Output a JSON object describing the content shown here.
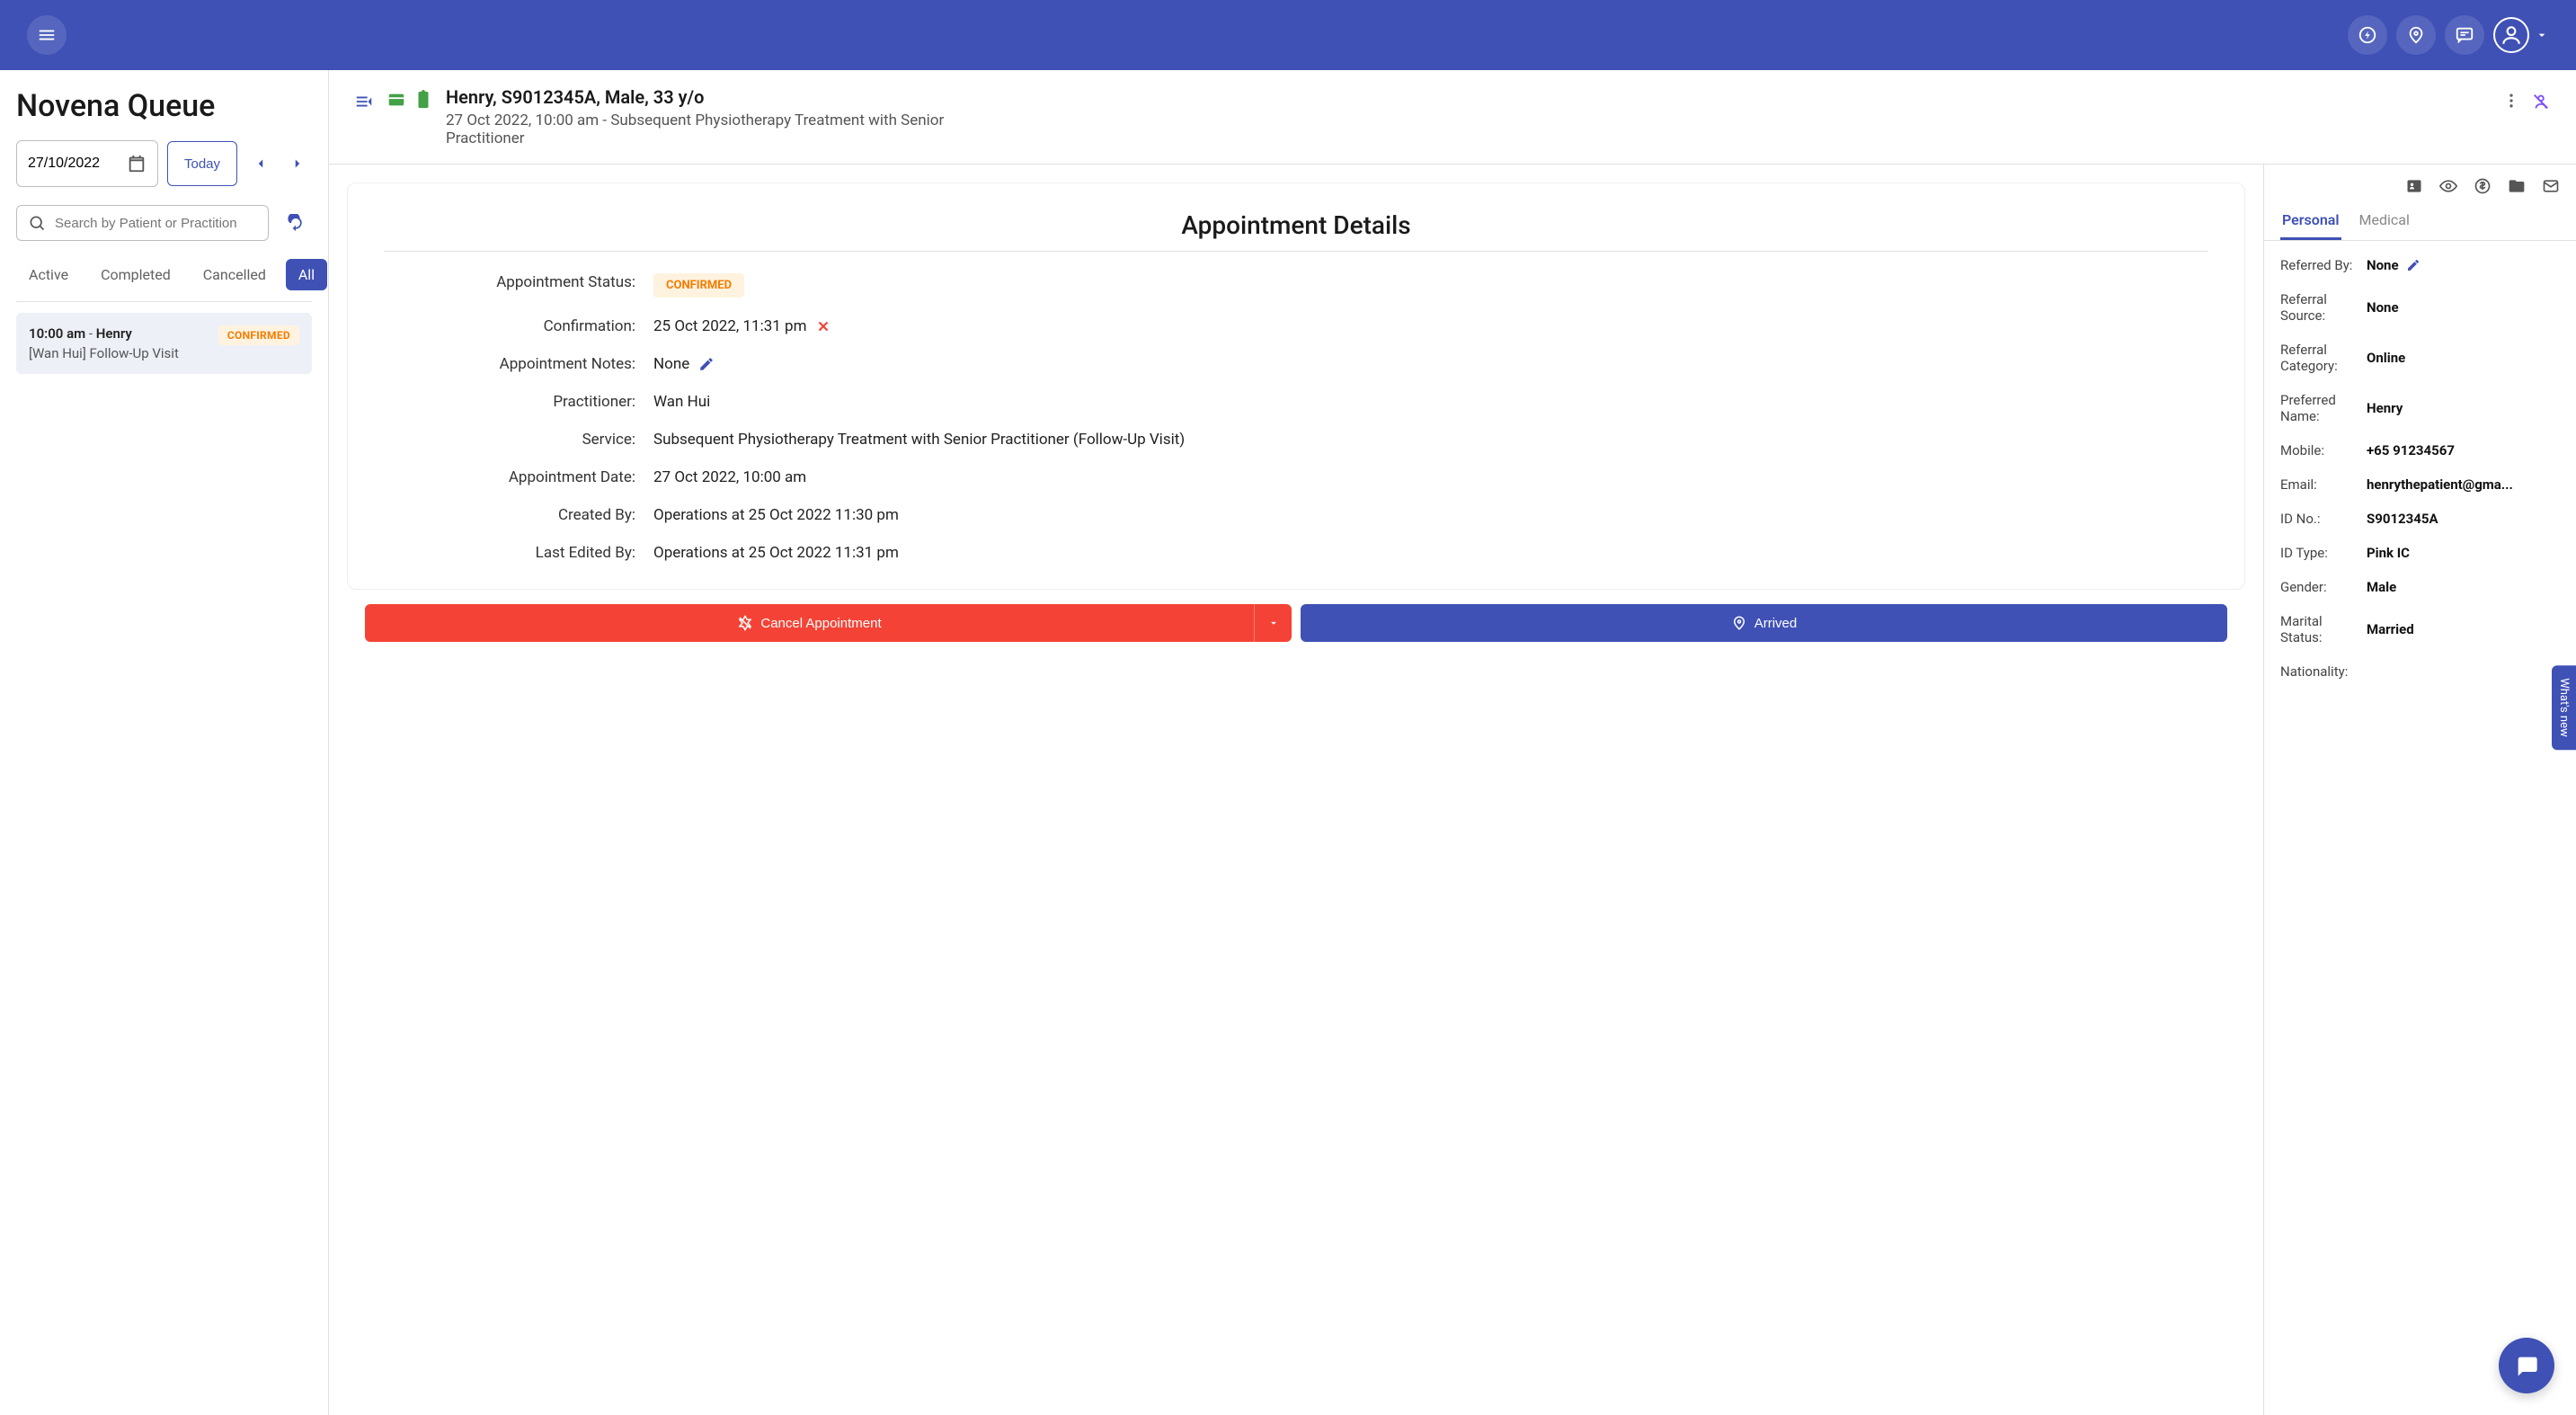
{
  "sidebar": {
    "title": "Novena Queue",
    "date": "27/10/2022",
    "today_label": "Today",
    "search_placeholder": "Search by Patient or Practition",
    "tabs": [
      "Active",
      "Completed",
      "Cancelled",
      "All"
    ],
    "active_tab": 3,
    "queue": [
      {
        "time": "10:00 am",
        "patient": "Henry",
        "sub": "[Wan Hui] Follow-Up Visit",
        "status": "CONFIRMED"
      }
    ]
  },
  "patient_header": {
    "name_line": "Henry, S9012345A, Male, 33 y/o",
    "sub_line": "27 Oct 2022, 10:00 am - Subsequent Physiotherapy Treatment with Senior Practitioner"
  },
  "details": {
    "title": "Appointment Details",
    "rows": {
      "status_label": "Appointment Status:",
      "status_value": "CONFIRMED",
      "confirmation_label": "Confirmation:",
      "confirmation_value": "25 Oct 2022, 11:31 pm",
      "notes_label": "Appointment Notes:",
      "notes_value": "None",
      "practitioner_label": "Practitioner:",
      "practitioner_value": "Wan Hui",
      "service_label": "Service:",
      "service_value": "Subsequent Physiotherapy Treatment with Senior Practitioner (Follow-Up Visit)",
      "date_label": "Appointment Date:",
      "date_value": "27 Oct 2022, 10:00 am",
      "created_label": "Created By:",
      "created_value": "Operations at 25 Oct 2022 11:30 pm",
      "edited_label": "Last Edited By:",
      "edited_value": "Operations at 25 Oct 2022 11:31 pm"
    }
  },
  "actions": {
    "cancel": "Cancel Appointment",
    "arrived": "Arrived"
  },
  "info": {
    "tabs": [
      "Personal",
      "Medical"
    ],
    "active_tab": 0,
    "fields": [
      {
        "label": "Referred By:",
        "value": "None",
        "editable": true
      },
      {
        "label": "Referral Source:",
        "value": "None"
      },
      {
        "label": "Referral Category:",
        "value": "Online"
      },
      {
        "label": "Preferred Name:",
        "value": "Henry"
      },
      {
        "label": "Mobile:",
        "value": "+65 91234567"
      },
      {
        "label": "Email:",
        "value": "henrythepatient@gma..."
      },
      {
        "label": "ID No.:",
        "value": "S9012345A"
      },
      {
        "label": "ID Type:",
        "value": "Pink IC"
      },
      {
        "label": "Gender:",
        "value": "Male"
      },
      {
        "label": "Marital Status:",
        "value": "Married"
      },
      {
        "label": "Nationality:",
        "value": ""
      }
    ]
  },
  "whats_new": "What's new"
}
